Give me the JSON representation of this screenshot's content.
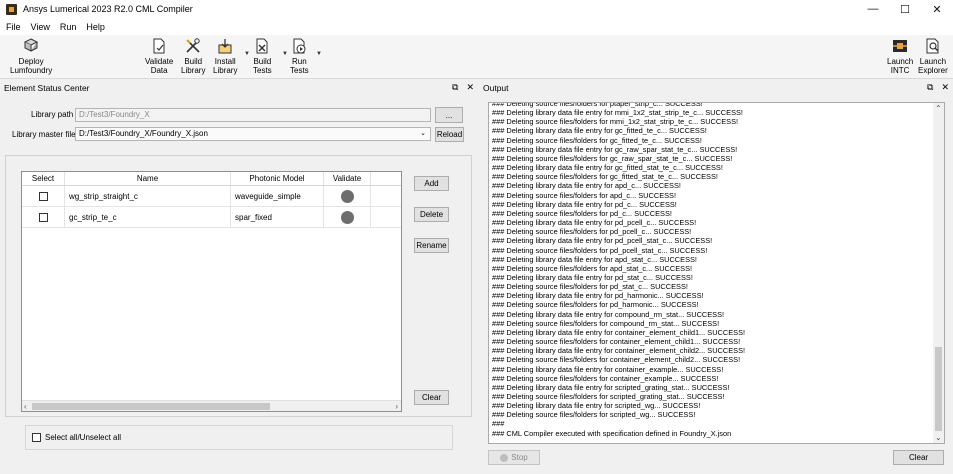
{
  "window": {
    "title": "Ansys Lumerical 2023 R2.0 CML Compiler",
    "minimize": "—",
    "maximize": "☐",
    "close": "✕"
  },
  "menu": [
    "File",
    "View",
    "Run",
    "Help"
  ],
  "toolbar": {
    "deploy": "Deploy\nLumfoundry",
    "validate": "Validate\nData",
    "build_library": "Build\nLibrary",
    "install_library": "Install\nLibrary",
    "build_tests": "Build\nTests",
    "run_tests": "Run\nTests",
    "launch_intc": "Launch\nINTC",
    "launch_explorer": "Launch\nExplorer"
  },
  "element_panel": {
    "title": "Element Status Center",
    "float_icon": "⧉",
    "close_icon": "✕",
    "library_path_label": "Library path",
    "library_path_value": "D:/Test3/Foundry_X",
    "browse_label": "...",
    "master_file_label": "Library master file",
    "master_file_value": "D:/Test3/Foundry_X/Foundry_X.json",
    "reload_label": "Reload",
    "table": {
      "headers": [
        "Select",
        "Name",
        "Photonic Model",
        "Validate"
      ],
      "rows": [
        {
          "name": "wg_strip_straight_c",
          "model": "waveguide_simple"
        },
        {
          "name": "gc_strip_te_c",
          "model": "spar_fixed"
        }
      ]
    },
    "buttons": {
      "add": "Add",
      "delete": "Delete",
      "rename": "Rename",
      "clear": "Clear"
    },
    "select_all_label": "Select all/Unselect all"
  },
  "output_panel": {
    "title": "Output",
    "float_icon": "⧉",
    "close_icon": "✕",
    "lines": [
      "### Deleting source files/folders for ptaper_strip_c... SUCCESS!",
      "### Deleting library data file entry for mmi_1x2_stat_strip_te_c... SUCCESS!",
      "### Deleting source files/folders for mmi_1x2_stat_strip_te_c... SUCCESS!",
      "### Deleting library data file entry for gc_fitted_te_c... SUCCESS!",
      "### Deleting source files/folders for gc_fitted_te_c... SUCCESS!",
      "### Deleting library data file entry for gc_raw_spar_stat_te_c... SUCCESS!",
      "### Deleting source files/folders for gc_raw_spar_stat_te_c... SUCCESS!",
      "### Deleting library data file entry for gc_fitted_stat_te_c... SUCCESS!",
      "### Deleting source files/folders for gc_fitted_stat_te_c... SUCCESS!",
      "### Deleting library data file entry for apd_c... SUCCESS!",
      "### Deleting source files/folders for apd_c... SUCCESS!",
      "### Deleting library data file entry for pd_c... SUCCESS!",
      "### Deleting source files/folders for pd_c... SUCCESS!",
      "### Deleting library data file entry for pd_pcell_c... SUCCESS!",
      "### Deleting source files/folders for pd_pcell_c... SUCCESS!",
      "### Deleting library data file entry for pd_pcell_stat_c... SUCCESS!",
      "### Deleting source files/folders for pd_pcell_stat_c... SUCCESS!",
      "### Deleting library data file entry for apd_stat_c... SUCCESS!",
      "### Deleting source files/folders for apd_stat_c... SUCCESS!",
      "### Deleting library data file entry for pd_stat_c... SUCCESS!",
      "### Deleting source files/folders for pd_stat_c... SUCCESS!",
      "### Deleting library data file entry for pd_harmonic... SUCCESS!",
      "### Deleting source files/folders for pd_harmonic... SUCCESS!",
      "### Deleting library data file entry for compound_rm_stat... SUCCESS!",
      "### Deleting source files/folders for compound_rm_stat... SUCCESS!",
      "### Deleting library data file entry for container_element_child1... SUCCESS!",
      "### Deleting source files/folders for container_element_child1... SUCCESS!",
      "### Deleting library data file entry for container_element_child2... SUCCESS!",
      "### Deleting source files/folders for container_element_child2... SUCCESS!",
      "### Deleting library data file entry for container_example... SUCCESS!",
      "### Deleting source files/folders for container_example... SUCCESS!",
      "### Deleting library data file entry for scripted_grating_stat... SUCCESS!",
      "### Deleting source files/folders for scripted_grating_stat... SUCCESS!",
      "### Deleting library data file entry for scripted_wg... SUCCESS!",
      "### Deleting source files/folders for scripted_wg... SUCCESS!",
      "###",
      "### CML Compiler executed with specification defined in Foundry_X.json"
    ],
    "stop_label": "Stop",
    "clear_label": "Clear"
  }
}
